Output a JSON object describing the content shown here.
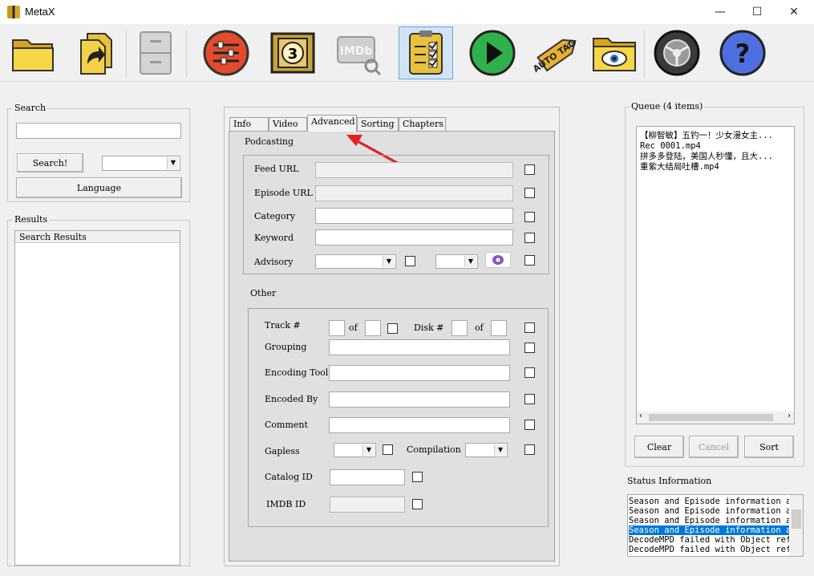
{
  "window": {
    "title": "MetaX",
    "minimize": "—",
    "maximize": "☐",
    "close": "✕"
  },
  "toolbar": {
    "buttons": [
      {
        "name": "open-folder-icon"
      },
      {
        "name": "open-file-icon"
      },
      {
        "name": "cabinet-icon"
      },
      {
        "name": "settings-sliders-icon"
      },
      {
        "name": "movie-countdown-icon"
      },
      {
        "name": "imdb-search-icon",
        "text": "IMDb"
      },
      {
        "name": "checklist-icon"
      },
      {
        "name": "play-icon"
      },
      {
        "name": "auto-tag-icon",
        "text": "AUTO TAG"
      },
      {
        "name": "view-folder-icon"
      },
      {
        "name": "preferences-wheel-icon"
      },
      {
        "name": "help-icon",
        "text": "?"
      }
    ]
  },
  "search": {
    "group_label": "Search",
    "input_value": "",
    "search_button": "Search!",
    "language_button": "Language"
  },
  "results": {
    "group_label": "Results",
    "column_header": "Search Results"
  },
  "tabs": [
    {
      "label": "Info"
    },
    {
      "label": "Video"
    },
    {
      "label": "Advanced"
    },
    {
      "label": "Sorting"
    },
    {
      "label": "Chapters"
    }
  ],
  "podcasting": {
    "label": "Podcasting",
    "feed_url": "Feed URL",
    "episode_url": "Episode URL",
    "category": "Category",
    "keyword": "Keyword",
    "advisory": "Advisory"
  },
  "other": {
    "label": "Other",
    "track": "Track #",
    "of1": "of",
    "disk": "Disk #",
    "of2": "of",
    "grouping": "Grouping",
    "encoding_tool": "Encoding Tool",
    "encoded_by": "Encoded By",
    "comment": "Comment",
    "gapless": "Gapless",
    "compilation": "Compilation",
    "catalog_id": "Catalog ID",
    "imdb_id": "IMDB ID"
  },
  "queue": {
    "label": "Queue (4 items)",
    "items": [
      "【柳智敏】五钓一！少女漫女主...",
      "Rec 0001.mp4",
      "拼多多登陆，美国人秒懂，且大...",
      "重紫大结局吐槽.mp4"
    ],
    "clear": "Clear",
    "cancel": "Cancel",
    "sort": "Sort"
  },
  "status": {
    "label": "Status Information",
    "lines": [
      "Season and Episode information al",
      "Season and Episode information al",
      "Season and Episode information al",
      "Season and Episode information al",
      "DecodeMPD failed with Object refe",
      "DecodeMPD failed with Object refe"
    ],
    "selected_index": 3
  },
  "colors": {
    "selection": "#0078d7",
    "arrow": "#e02020",
    "active_tool": "#cfe4f7"
  }
}
